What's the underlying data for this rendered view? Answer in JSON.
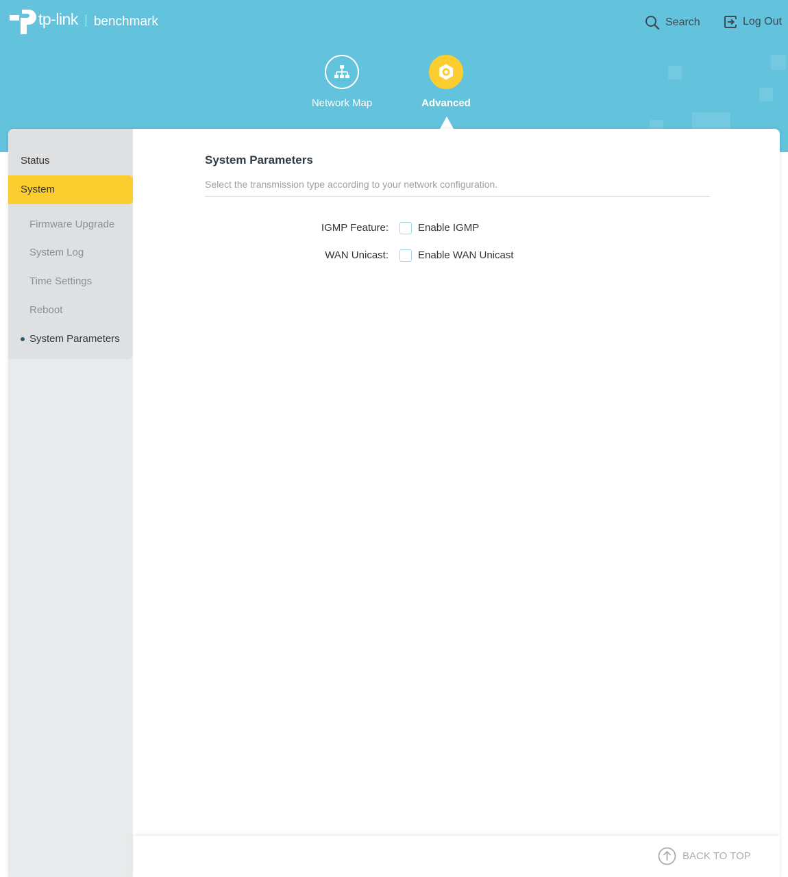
{
  "brand": {
    "name": "tp-link",
    "model": "benchmark"
  },
  "top_actions": {
    "search_label": "Search",
    "logout_label": "Log Out"
  },
  "mode_tabs": [
    {
      "label": "Network Map",
      "icon": "network-map-icon",
      "active": false
    },
    {
      "label": "Advanced",
      "icon": "gear-icon",
      "active": true
    }
  ],
  "sidebar": {
    "status_label": "Status",
    "system_label": "System",
    "sub_items": [
      {
        "label": "Firmware Upgrade",
        "active": false
      },
      {
        "label": "System Log",
        "active": false
      },
      {
        "label": "Time Settings",
        "active": false
      },
      {
        "label": "Reboot",
        "active": false
      },
      {
        "label": "System Parameters",
        "active": true
      }
    ]
  },
  "main": {
    "title": "System Parameters",
    "description": "Select the transmission type according to your network configuration.",
    "fields": [
      {
        "label": "IGMP Feature:",
        "checkbox_label": "Enable IGMP",
        "checked": false
      },
      {
        "label": "WAN Unicast:",
        "checkbox_label": "Enable WAN Unicast",
        "checked": false
      }
    ]
  },
  "footer": {
    "back_to_top": "BACK TO TOP"
  },
  "colors": {
    "header_blue": "#63c3dd",
    "accent_yellow": "#fbcd2f",
    "sidebar_gray": "#e9eaeb"
  }
}
